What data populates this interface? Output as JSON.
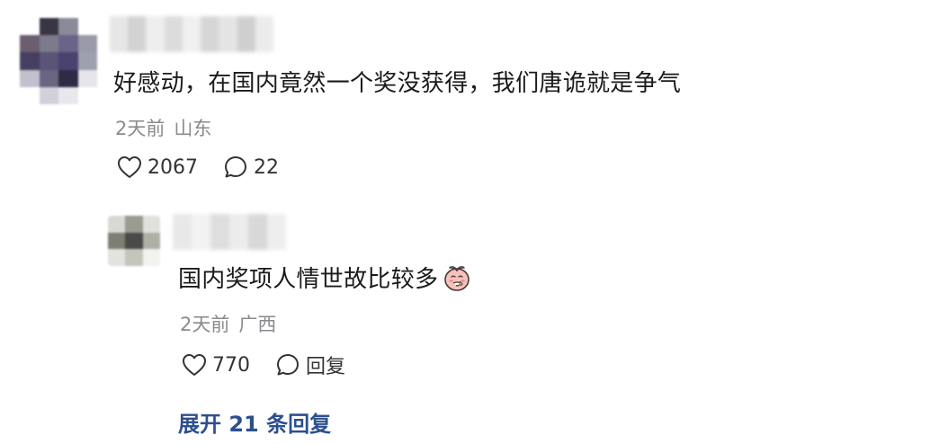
{
  "comment": {
    "text": "好感动，在国内竟然一个奖没获得，我们唐诡就是争气",
    "time": "2天前",
    "location": "山东",
    "like_count": "2067",
    "reply_count": "22"
  },
  "reply": {
    "text": "国内奖项人情世故比较多",
    "emoji": "peach-face-emoji",
    "time": "2天前",
    "location": "广西",
    "like_count": "770",
    "reply_label": "回复"
  },
  "expand_replies_label": "展开 21 条回复",
  "colors": {
    "text_primary": "#1a1a1a",
    "text_meta": "#8a8a8f",
    "link": "#2d4f8f"
  }
}
